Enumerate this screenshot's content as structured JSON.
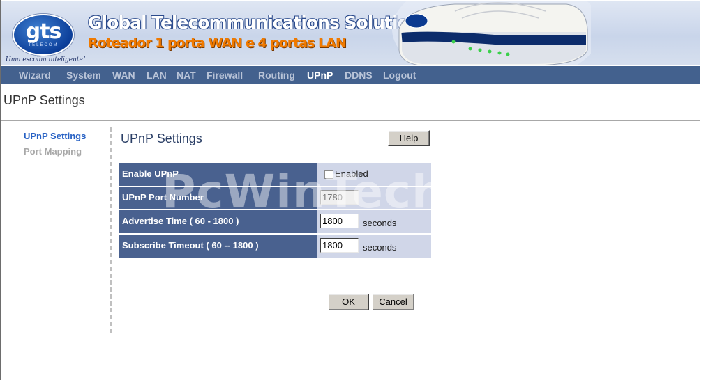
{
  "banner": {
    "logo_text": "gts",
    "logo_subtext": "TELECOM",
    "slogan": "Uma escolha inteligente!",
    "title": "Global Telecommunications Solutions",
    "subtitle": "Roteador 1 porta WAN e 4 portas LAN"
  },
  "nav": {
    "items": [
      "Wizard",
      "System",
      "WAN",
      "LAN",
      "NAT",
      "Firewall",
      "Routing",
      "UPnP",
      "DDNS",
      "Logout"
    ],
    "active": "UPnP"
  },
  "page": {
    "title": "UPnP Settings"
  },
  "sidebar": {
    "items": [
      {
        "label": "UPnP Settings"
      },
      {
        "label": "Port Mapping"
      }
    ]
  },
  "content": {
    "title": "UPnP Settings",
    "help_label": "Help",
    "fields": [
      {
        "label": "Enable UPnP",
        "checkbox_label": "Enabled",
        "checked": false
      },
      {
        "label": "UPnP Port Number",
        "value": "1780"
      },
      {
        "label": "Advertise Time ( 60 - 1800 )",
        "value": "1800",
        "unit": "seconds"
      },
      {
        "label": "Subscribe Timeout ( 60 -- 1800 )",
        "value": "1800",
        "unit": "seconds"
      }
    ],
    "ok_label": "OK",
    "cancel_label": "Cancel"
  },
  "watermark": "PcWinTech.com",
  "colors": {
    "nav_bg": "#43618e",
    "label_bg": "#49618f",
    "value_bg": "#d0d6e8",
    "link_active": "#2761c4",
    "orange_subtitle": "#f07a00"
  }
}
